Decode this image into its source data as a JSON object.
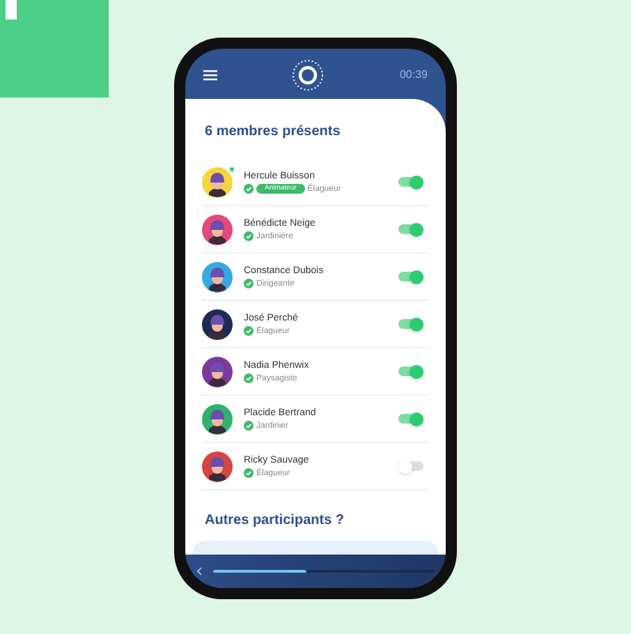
{
  "header": {
    "time": "00:39"
  },
  "title": "6 membres présents",
  "members": [
    {
      "name": "Hercule Buisson",
      "badge": "Animateur",
      "role": "Élagueur",
      "color": "#f5d63d",
      "online": true,
      "on": true
    },
    {
      "name": "Bénédicte Neige",
      "role": "Jardinière",
      "color": "#e5487a",
      "online": false,
      "on": true
    },
    {
      "name": "Constance Dubois",
      "role": "Dirigeante",
      "color": "#36a9e1",
      "online": false,
      "on": true
    },
    {
      "name": "José Perché",
      "role": "Élagueur",
      "color": "#1d2b52",
      "online": false,
      "on": true
    },
    {
      "name": "Nadia Phenwix",
      "role": "Paysagiste",
      "color": "#7a3a9a",
      "online": false,
      "on": true
    },
    {
      "name": "Placide Bertrand",
      "role": "Jardinier",
      "color": "#2fb36a",
      "online": false,
      "on": true
    },
    {
      "name": "Ricky Sauvage",
      "role": "Élagueur",
      "color": "#d6453f",
      "online": false,
      "on": false
    }
  ],
  "others_title": "Autres participants ?",
  "progress": {
    "level": 0.42
  }
}
